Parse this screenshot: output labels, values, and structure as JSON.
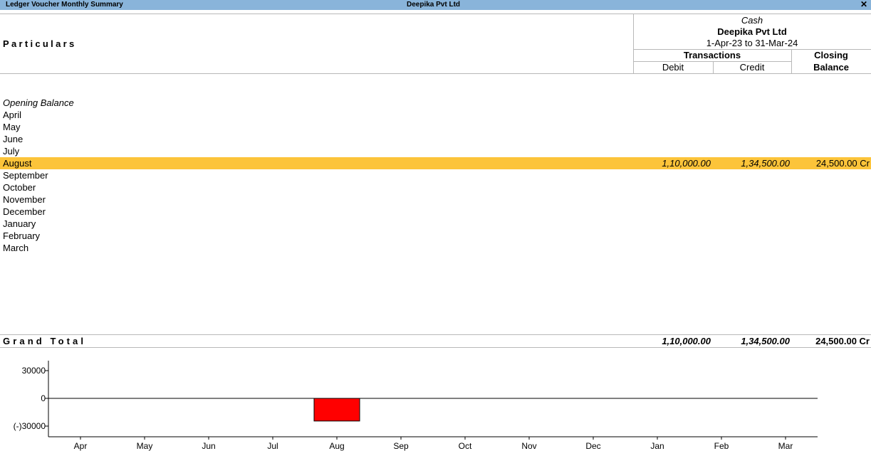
{
  "window": {
    "title": "Ledger Voucher Monthly Summary",
    "company": "Deepika Pvt Ltd",
    "close_icon": "close-icon"
  },
  "header": {
    "particulars_label": "Particulars",
    "ledger_name": "Cash",
    "company_name": "Deepika Pvt Ltd",
    "period": "1-Apr-23 to 31-Mar-24",
    "transactions_label": "Transactions",
    "debit_label": "Debit",
    "credit_label": "Credit",
    "closing_label_line1": "Closing",
    "closing_label_line2": "Balance"
  },
  "rows": [
    {
      "label": "Opening Balance",
      "debit": "",
      "credit": "",
      "closing": ""
    },
    {
      "label": "April",
      "debit": "",
      "credit": "",
      "closing": ""
    },
    {
      "label": "May",
      "debit": "",
      "credit": "",
      "closing": ""
    },
    {
      "label": "June",
      "debit": "",
      "credit": "",
      "closing": ""
    },
    {
      "label": "July",
      "debit": "",
      "credit": "",
      "closing": ""
    },
    {
      "label": "August",
      "debit": "1,10,000.00",
      "credit": "1,34,500.00",
      "closing": "24,500.00 Cr"
    },
    {
      "label": "September",
      "debit": "",
      "credit": "",
      "closing": ""
    },
    {
      "label": "October",
      "debit": "",
      "credit": "",
      "closing": ""
    },
    {
      "label": "November",
      "debit": "",
      "credit": "",
      "closing": ""
    },
    {
      "label": "December",
      "debit": "",
      "credit": "",
      "closing": ""
    },
    {
      "label": "January",
      "debit": "",
      "credit": "",
      "closing": ""
    },
    {
      "label": "February",
      "debit": "",
      "credit": "",
      "closing": ""
    },
    {
      "label": "March",
      "debit": "",
      "credit": "",
      "closing": ""
    }
  ],
  "grand_total": {
    "label": "Grand Total",
    "debit": "1,10,000.00",
    "credit": "1,34,500.00",
    "closing": "24,500.00 Cr"
  },
  "chart_data": {
    "type": "bar",
    "categories": [
      "Apr",
      "May",
      "Jun",
      "Jul",
      "Aug",
      "Sep",
      "Oct",
      "Nov",
      "Dec",
      "Jan",
      "Feb",
      "Mar"
    ],
    "values": [
      0,
      0,
      0,
      0,
      -24500,
      0,
      0,
      0,
      0,
      0,
      0,
      0
    ],
    "y_ticks": [
      30000,
      0,
      -30000
    ],
    "y_tick_labels": [
      "30000",
      "0",
      "(-)30000"
    ],
    "ylim": [
      -35000,
      35000
    ],
    "bar_color": "#ff0000",
    "title": "",
    "xlabel": "",
    "ylabel": ""
  }
}
